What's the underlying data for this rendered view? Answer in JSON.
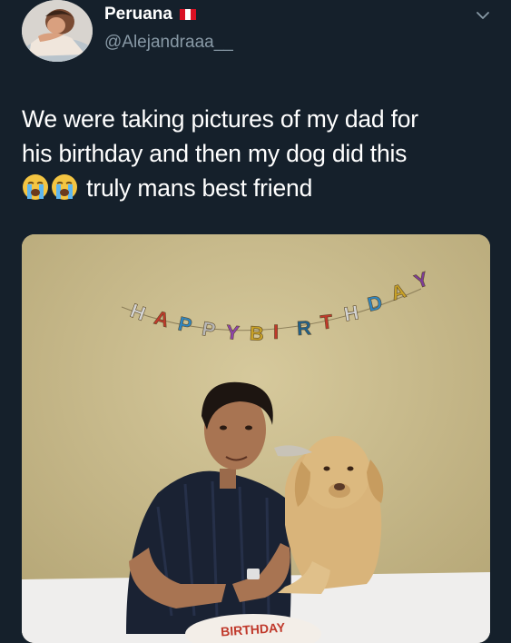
{
  "user": {
    "display_name": "Peruana",
    "handle": "@Alejandraaa__",
    "avatar_icon": "profile-avatar",
    "flag_icon": "peru-flag-icon"
  },
  "tweet": {
    "lines": [
      "We were taking pictures of my dad for",
      "his birthday and then my dog did this",
      "truly mans best friend"
    ],
    "emoji": [
      "loudly-crying-face-icon",
      "loudly-crying-face-icon"
    ]
  },
  "photo": {
    "banner_letters": [
      "H",
      "A",
      "P",
      "P",
      "Y",
      "B",
      "I",
      "R",
      "T",
      "H",
      "D",
      "A",
      "Y"
    ],
    "cake_text": "BIRTHDAY"
  },
  "colors": {
    "background": "#15202b",
    "text": "#ffffff",
    "secondary_text": "#8899a6"
  }
}
